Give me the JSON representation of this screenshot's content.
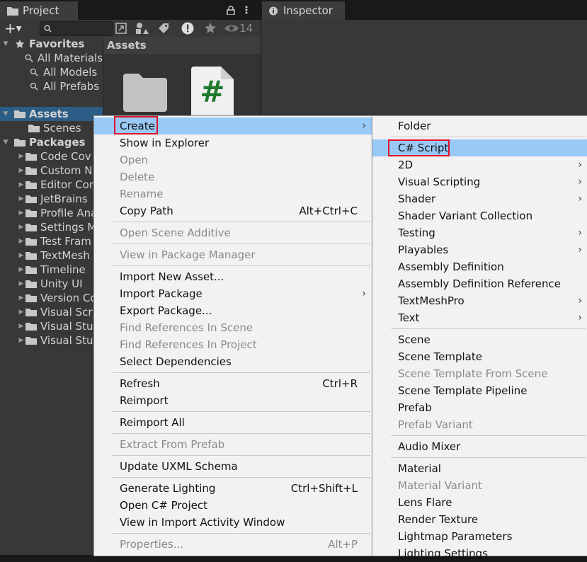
{
  "tabs": {
    "project": "Project",
    "inspector": "Inspector"
  },
  "toolbar": {
    "hidden_count": "14"
  },
  "tree": {
    "favorites_label": "Favorites",
    "favorites": [
      "All Materials",
      "All Models",
      "All Prefabs"
    ],
    "assets_label": "Assets",
    "assets_children": [
      "Scenes"
    ],
    "packages_label": "Packages",
    "packages": [
      "Code Cov",
      "Custom N",
      "Editor Cor",
      "JetBrains",
      "Profile Ana",
      "Settings M",
      "Test Fram",
      "TextMesh",
      "Timeline",
      "Unity UI",
      "Version Co",
      "Visual Scr",
      "Visual Stu",
      "Visual Stu"
    ]
  },
  "grid": {
    "header": "Assets"
  },
  "context_menu": {
    "items": [
      {
        "label": "Create",
        "highlighted": true,
        "submenu": true
      },
      {
        "label": "Show in Explorer"
      },
      {
        "label": "Open",
        "disabled": true
      },
      {
        "label": "Delete",
        "disabled": true
      },
      {
        "label": "Rename",
        "disabled": true
      },
      {
        "label": "Copy Path",
        "shortcut": "Alt+Ctrl+C"
      },
      {
        "label": "Open Scene Additive",
        "disabled": true
      },
      {
        "label": "View in Package Manager",
        "disabled": true
      },
      {
        "label": "Import New Asset..."
      },
      {
        "label": "Import Package",
        "submenu": true
      },
      {
        "label": "Export Package..."
      },
      {
        "label": "Find References In Scene",
        "disabled": true
      },
      {
        "label": "Find References In Project",
        "disabled": true
      },
      {
        "label": "Select Dependencies"
      },
      {
        "label": "Refresh",
        "shortcut": "Ctrl+R"
      },
      {
        "label": "Reimport"
      },
      {
        "label": "Reimport All"
      },
      {
        "label": "Extract From Prefab",
        "disabled": true
      },
      {
        "label": "Update UXML Schema"
      },
      {
        "label": "Generate Lighting",
        "shortcut": "Ctrl+Shift+L"
      },
      {
        "label": "Open C# Project"
      },
      {
        "label": "View in Import Activity Window"
      },
      {
        "label": "Properties...",
        "shortcut": "Alt+P",
        "disabled": true
      }
    ]
  },
  "create_submenu": {
    "items": [
      {
        "label": "Folder"
      },
      {
        "label": "C# Script",
        "highlighted": true
      },
      {
        "label": "2D",
        "submenu": true
      },
      {
        "label": "Visual Scripting",
        "submenu": true
      },
      {
        "label": "Shader",
        "submenu": true
      },
      {
        "label": "Shader Variant Collection"
      },
      {
        "label": "Testing",
        "submenu": true
      },
      {
        "label": "Playables",
        "submenu": true
      },
      {
        "label": "Assembly Definition"
      },
      {
        "label": "Assembly Definition Reference"
      },
      {
        "label": "TextMeshPro",
        "submenu": true
      },
      {
        "label": "Text",
        "submenu": true
      },
      {
        "label": "Scene"
      },
      {
        "label": "Scene Template"
      },
      {
        "label": "Scene Template From Scene",
        "disabled": true
      },
      {
        "label": "Scene Template Pipeline"
      },
      {
        "label": "Prefab"
      },
      {
        "label": "Prefab Variant",
        "disabled": true
      },
      {
        "label": "Audio Mixer"
      },
      {
        "label": "Material"
      },
      {
        "label": "Material Variant",
        "disabled": true
      },
      {
        "label": "Lens Flare"
      },
      {
        "label": "Render Texture"
      },
      {
        "label": "Lightmap Parameters"
      },
      {
        "label": "Lighting Settings"
      }
    ]
  },
  "colors": {
    "highlight": "#99c9f7",
    "annotation_red": "#e0102a",
    "selection": "#2c5d87"
  }
}
